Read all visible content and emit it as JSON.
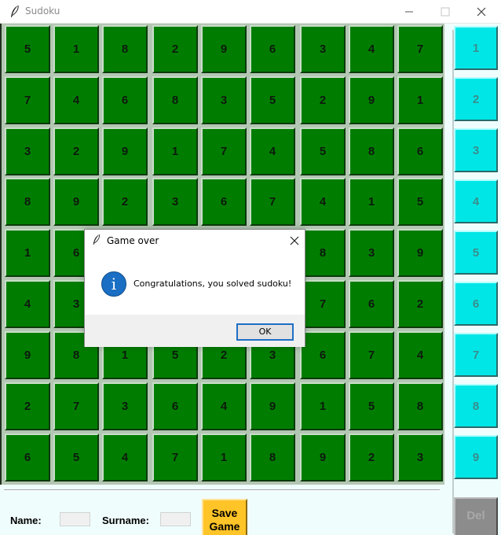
{
  "window": {
    "title": "Sudoku"
  },
  "grid": [
    [
      "5",
      "1",
      "8",
      "2",
      "9",
      "6",
      "3",
      "4",
      "7"
    ],
    [
      "7",
      "4",
      "6",
      "8",
      "3",
      "5",
      "2",
      "9",
      "1"
    ],
    [
      "3",
      "2",
      "9",
      "1",
      "7",
      "4",
      "5",
      "8",
      "6"
    ],
    [
      "8",
      "9",
      "2",
      "3",
      "6",
      "7",
      "4",
      "1",
      "5"
    ],
    [
      "1",
      "6",
      "",
      "",
      "",
      "",
      "8",
      "3",
      "9"
    ],
    [
      "4",
      "3",
      "",
      "",
      "",
      "",
      "7",
      "6",
      "2"
    ],
    [
      "9",
      "8",
      "1",
      "5",
      "2",
      "3",
      "6",
      "7",
      "4"
    ],
    [
      "2",
      "7",
      "3",
      "6",
      "4",
      "9",
      "1",
      "5",
      "8"
    ],
    [
      "6",
      "5",
      "4",
      "7",
      "1",
      "8",
      "9",
      "2",
      "3"
    ]
  ],
  "keypad": [
    "1",
    "2",
    "3",
    "4",
    "5",
    "6",
    "7",
    "8",
    "9"
  ],
  "delete_label": "Del",
  "form": {
    "name_label": "Name:",
    "name_value": "",
    "surname_label": "Surname:",
    "surname_value": "",
    "save_label_line1": "Save",
    "save_label_line2": "Game"
  },
  "dialog": {
    "title": "Game over",
    "message": "Congratulations, you solved sudoku!",
    "ok_label": "OK",
    "info_glyph": "i"
  },
  "icons": {
    "app": "feather-icon",
    "minimize": "minimize-icon",
    "maximize": "maximize-icon",
    "close": "close-icon",
    "info": "info-icon"
  },
  "colors": {
    "cell": "#007d00",
    "keypad": "#00e6e6",
    "delete": "#8c8c8c",
    "save": "#ffc427",
    "info": "#1a6fc4"
  }
}
